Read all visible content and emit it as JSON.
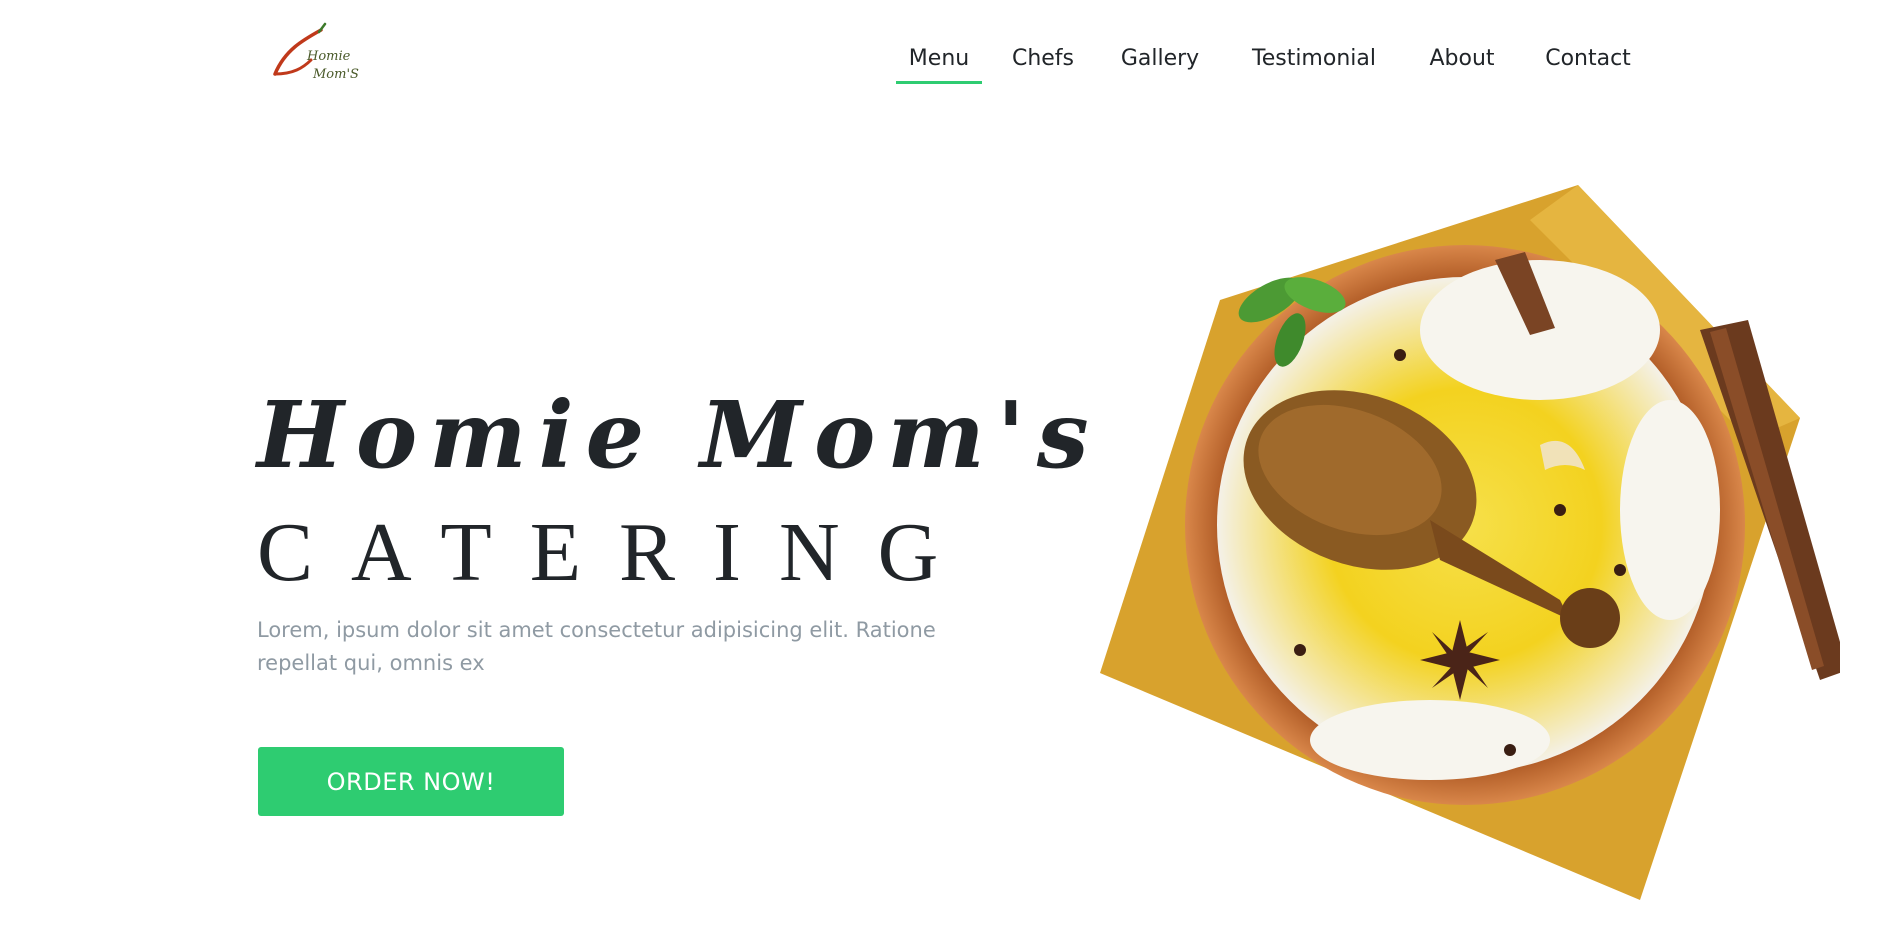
{
  "brand": {
    "logo_line1": "Homie",
    "logo_line2": "Mom'S",
    "accent_color": "#2ecc71"
  },
  "nav": {
    "items": [
      {
        "label": "Menu",
        "active": true
      },
      {
        "label": "Chefs"
      },
      {
        "label": "Gallery"
      },
      {
        "label": "Testimonial"
      },
      {
        "label": "About"
      },
      {
        "label": "Contact"
      }
    ]
  },
  "hero": {
    "title": "Homie Mom's",
    "subtitle": "CATERING",
    "description": "Lorem, ipsum dolor sit amet consectetur adipisicing elit. Ratione repellat qui, omnis ex",
    "cta_label": "ORDER NOW!"
  }
}
